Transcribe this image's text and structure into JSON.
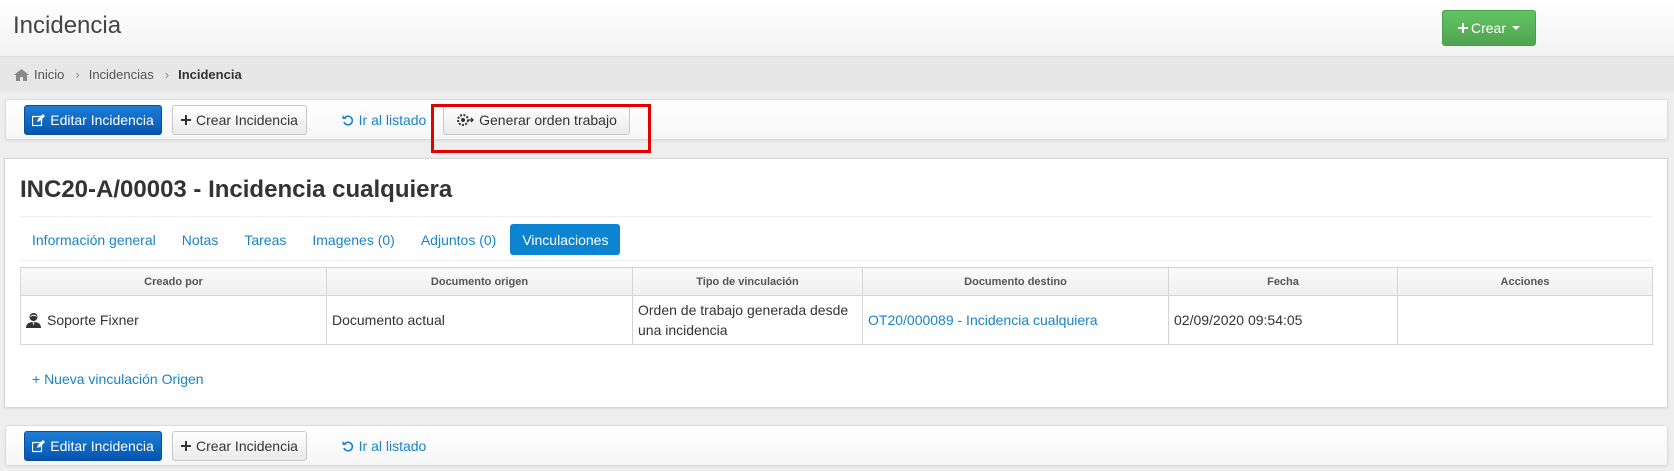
{
  "header": {
    "title": "Incidencia",
    "create_label": "Crear"
  },
  "breadcrumb": {
    "items": [
      "Inicio",
      "Incidencias",
      "Incidencia"
    ]
  },
  "toolbar": {
    "edit_label": "Editar Incidencia",
    "create_label": "Crear Incidencia",
    "list_label": "Ir al listado",
    "generate_label": "Generar orden trabajo"
  },
  "document": {
    "title": "INC20-A/00003 - Incidencia cualquiera"
  },
  "tabs": [
    {
      "label": "Información general",
      "active": false
    },
    {
      "label": "Notas",
      "active": false
    },
    {
      "label": "Tareas",
      "active": false
    },
    {
      "label": "Imagenes (0)",
      "active": false
    },
    {
      "label": "Adjuntos (0)",
      "active": false
    },
    {
      "label": "Vinculaciones",
      "active": true
    }
  ],
  "table": {
    "headers": [
      "Creado por",
      "Documento origen",
      "Tipo de vinculación",
      "Documento destino",
      "Fecha",
      "Acciones"
    ],
    "rows": [
      {
        "created_by": "Soporte Fixner",
        "origin": "Documento actual",
        "link_type": "Orden de trabajo generada desde una incidencia",
        "target": "OT20/000089 - Incidencia cualquiera",
        "date": "02/09/2020 09:54:05",
        "actions": ""
      }
    ]
  },
  "add_link_label": "+ Nueva vinculación Origen",
  "icons": {
    "home": "home-icon",
    "plus": "plus-icon",
    "edit": "edit-icon",
    "undo": "undo-icon",
    "gear_arrow": "gear-arrow-icon",
    "user": "user-icon"
  },
  "colors": {
    "primary": "#0655b0",
    "success": "#51a351",
    "link": "#1a84c7",
    "active_tab": "#0d84d1",
    "highlight": "#e30000"
  }
}
